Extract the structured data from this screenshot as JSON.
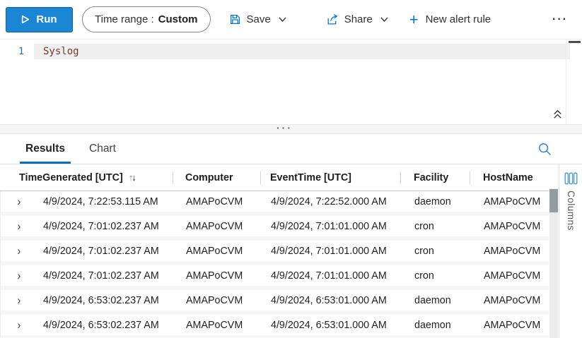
{
  "toolbar": {
    "run_label": "Run",
    "time_range_label": "Time range :",
    "time_range_value": "Custom",
    "save_label": "Save",
    "share_label": "Share",
    "new_alert_rule_label": "New alert rule",
    "more_label": "···"
  },
  "editor": {
    "line_number": "1",
    "query": "Syslog"
  },
  "results_panel": {
    "tabs": [
      {
        "label": "Results",
        "active": true
      },
      {
        "label": "Chart",
        "active": false
      }
    ],
    "columns_label": "Columns"
  },
  "table": {
    "headers": [
      "TimeGenerated [UTC]",
      "Computer",
      "EventTime [UTC]",
      "Facility",
      "HostName"
    ],
    "rows": [
      [
        "4/9/2024, 7:22:53.115 AM",
        "AMAPoCVM",
        "4/9/2024, 7:22:52.000 AM",
        "daemon",
        "AMAPoCVM"
      ],
      [
        "4/9/2024, 7:01:02.237 AM",
        "AMAPoCVM",
        "4/9/2024, 7:01:01.000 AM",
        "cron",
        "AMAPoCVM"
      ],
      [
        "4/9/2024, 7:01:02.237 AM",
        "AMAPoCVM",
        "4/9/2024, 7:01:01.000 AM",
        "cron",
        "AMAPoCVM"
      ],
      [
        "4/9/2024, 7:01:02.237 AM",
        "AMAPoCVM",
        "4/9/2024, 7:01:01.000 AM",
        "cron",
        "AMAPoCVM"
      ],
      [
        "4/9/2024, 6:53:02.237 AM",
        "AMAPoCVM",
        "4/9/2024, 6:53:01.000 AM",
        "daemon",
        "AMAPoCVM"
      ],
      [
        "4/9/2024, 6:53:02.237 AM",
        "AMAPoCVM",
        "4/9/2024, 6:53:01.000 AM",
        "daemon",
        "AMAPoCVM"
      ]
    ]
  },
  "icons": {
    "sort_asc": "↑",
    "sort_desc": "↓",
    "row_expand": "›",
    "drag_handle": "···"
  },
  "colors": {
    "accent": "#0078d4",
    "run_button_bg": "#1b87d4",
    "tab_underline": "#0f6cbd",
    "query_table_name": "#7b3430",
    "line_number": "#2977a8",
    "scroll_thumb": "#929ca1"
  }
}
